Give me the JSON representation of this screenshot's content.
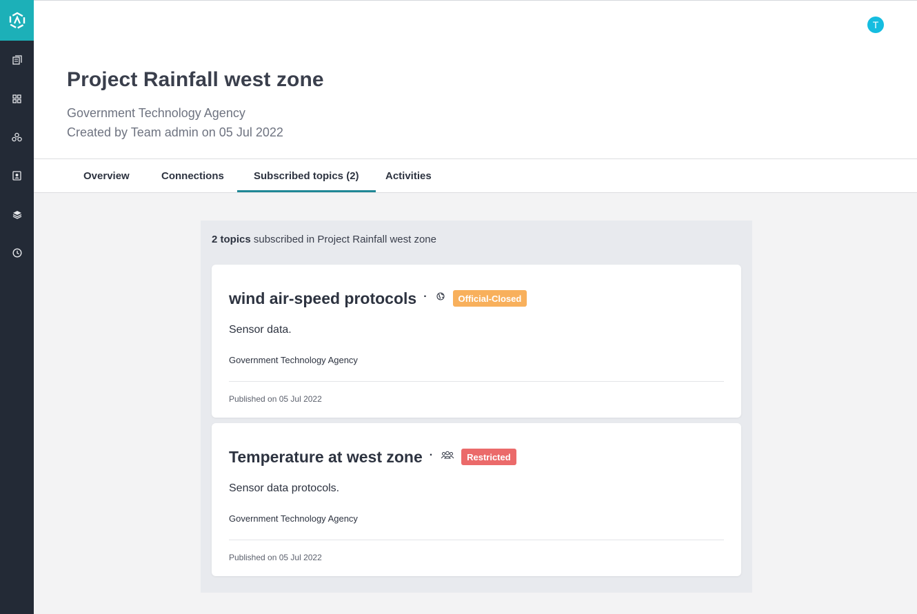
{
  "sidebar": {
    "items": [
      {
        "icon": "catalog-icon"
      },
      {
        "icon": "grid-icon"
      },
      {
        "icon": "network-icon"
      },
      {
        "icon": "contact-card-icon"
      },
      {
        "icon": "layers-icon"
      },
      {
        "icon": "clock-icon"
      }
    ]
  },
  "header": {
    "avatar_initial": "T",
    "title": "Project Rainfall west zone",
    "organization": "Government Technology Agency",
    "created": "Created by Team admin on 05 Jul 2022"
  },
  "tabs": [
    {
      "label": "Overview",
      "active": false
    },
    {
      "label": "Connections",
      "active": false
    },
    {
      "label": "Subscribed topics (2)",
      "active": true
    },
    {
      "label": "Activities",
      "active": false
    }
  ],
  "summary": {
    "count": "2 topics",
    "rest": " subscribed in Project Rainfall west zone"
  },
  "topics": [
    {
      "title": "wind air-speed protocols",
      "visibility_icon": "globe-icon",
      "badge": "Official-Closed",
      "badge_color": "#f8b05c",
      "description": "Sensor data.",
      "organization": "Government Technology Agency",
      "published": "Published on 05 Jul 2022"
    },
    {
      "title": "Temperature at west zone",
      "visibility_icon": "group-icon",
      "badge": "Restricted",
      "badge_color": "#eb6a6a",
      "description": "Sensor data protocols.",
      "organization": "Government Technology Agency",
      "published": "Published on 05 Jul 2022"
    }
  ],
  "colors": {
    "sidebar": "#232a36",
    "brand": "#1cb0b8",
    "tab_underline": "#1f8795",
    "avatar": "#15bde0"
  }
}
